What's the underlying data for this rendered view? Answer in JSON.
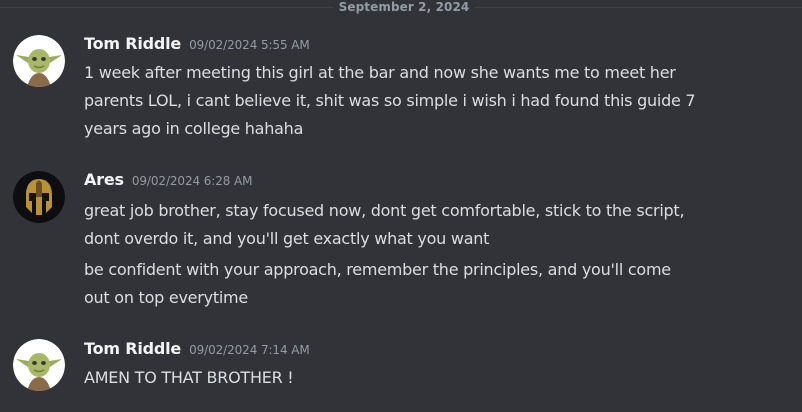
{
  "divider": {
    "label": "September 2, 2024"
  },
  "messages": [
    {
      "author": "Tom Riddle",
      "timestamp": "09/02/2024 5:55 AM",
      "avatar_icon": "yoda-avatar-icon",
      "lines": [
        "1 week after meeting this girl at the bar and now she wants me to meet her\nparents LOL, i cant believe it, shit was so simple i wish i had found this guide 7\nyears ago in college hahaha"
      ]
    },
    {
      "author": "Ares",
      "timestamp": "09/02/2024 6:28 AM",
      "avatar_icon": "spartan-helmet-avatar-icon",
      "lines": [
        "great job brother, stay focused now, dont get comfortable, stick to the script,\ndont overdo it, and you'll get exactly what you want",
        "be confident with your approach, remember the principles, and you'll come\nout on top everytime"
      ]
    },
    {
      "author": "Tom Riddle",
      "timestamp": "09/02/2024 7:14 AM",
      "avatar_icon": "yoda-avatar-icon",
      "lines": [
        "AMEN TO THAT BROTHER !"
      ]
    }
  ],
  "colors": {
    "background": "#313338",
    "author": "#f2f3f5",
    "text": "#dbdee1",
    "muted": "#949ba4"
  }
}
